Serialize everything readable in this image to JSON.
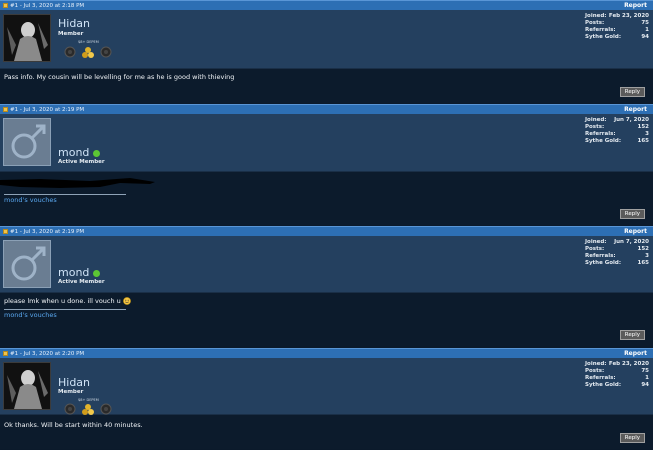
{
  "report_label": "Report",
  "reply_label": "Reply",
  "stat_labels": {
    "joined": "Joined:",
    "posts": "Posts:",
    "referrals": "Referrals:",
    "gold": "Sythe Gold:"
  },
  "posts": [
    {
      "header": "#1 - Jul 3, 2020 at 2:18 PM",
      "username": "Hidan",
      "title": "Member",
      "avatar": "dark-character-avatar",
      "badge_caption": "$8+ DEPEM",
      "stats": {
        "joined": "Feb 23, 2020",
        "posts": "75",
        "referrals": "1",
        "gold": "94"
      },
      "message": "Pass info. My cousin will be levelling for me as he is good with thieving",
      "vouch": ""
    },
    {
      "header": "#1 - Jul 3, 2020 at 2:19 PM",
      "username": "mond",
      "title": "Active Member",
      "avatar": "default-male-avatar",
      "online": true,
      "stats": {
        "joined": "Jun 7, 2020",
        "posts": "152",
        "referrals": "3",
        "gold": "165"
      },
      "message": "",
      "vouch": "mond's vouches"
    },
    {
      "header": "#1 - Jul 3, 2020 at 2:19 PM",
      "username": "mond",
      "title": "Active Member",
      "avatar": "default-male-avatar",
      "online": true,
      "stats": {
        "joined": "Jun 7, 2020",
        "posts": "152",
        "referrals": "3",
        "gold": "165"
      },
      "message": "please lmk when u done. ill vouch u",
      "emoji": "smile-emoji",
      "vouch": "mond's vouches"
    },
    {
      "header": "#1 - Jul 3, 2020 at 2:20 PM",
      "username": "Hidan",
      "title": "Member",
      "avatar": "dark-character-avatar",
      "badge_caption": "$8+ DEPEM",
      "stats": {
        "joined": "Feb 23, 2020",
        "posts": "75",
        "referrals": "1",
        "gold": "94"
      },
      "message": "Ok thanks. Will be start within 40 minutes.",
      "vouch": ""
    }
  ]
}
